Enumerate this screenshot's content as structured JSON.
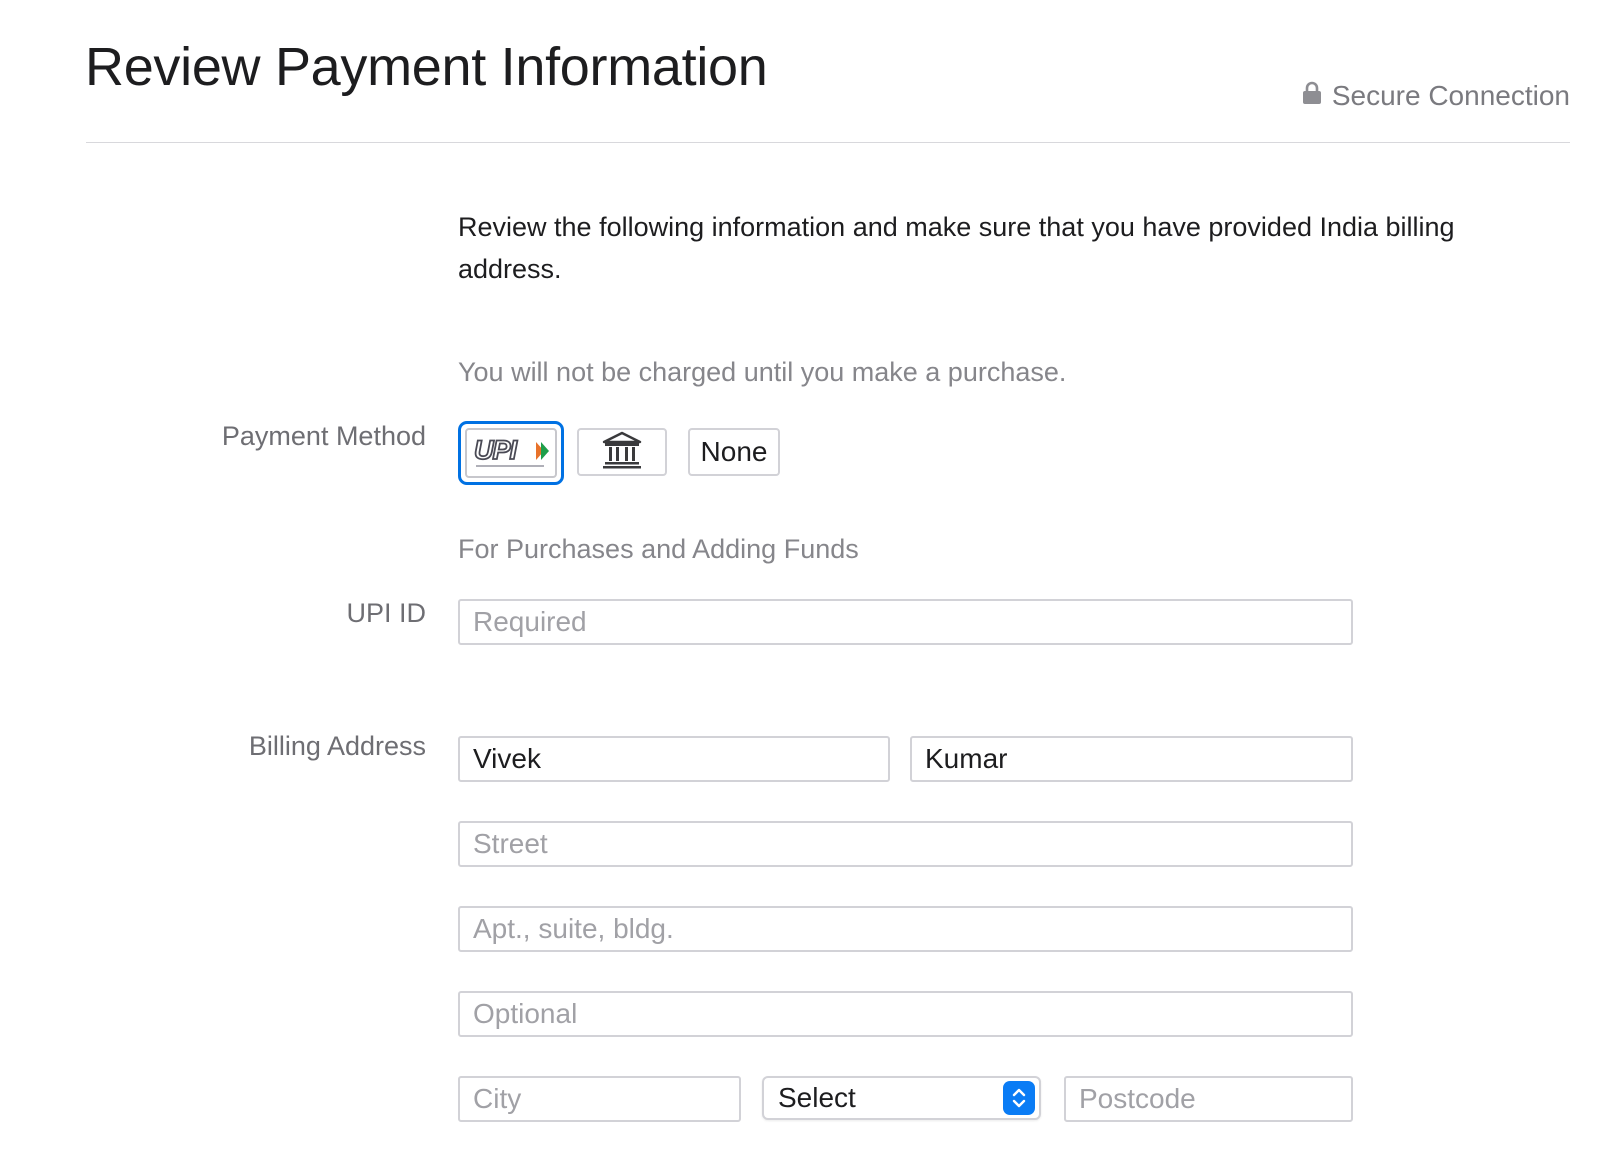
{
  "header": {
    "title": "Review Payment Information",
    "secure_label": "Secure Connection"
  },
  "intro_text": "Review the following information and make sure that you have provided India billing address.",
  "charge_note": "You will not be charged until you make a purchase.",
  "payment_method": {
    "label": "Payment Method",
    "options": [
      {
        "id": "upi",
        "logo_text": "UPI",
        "icon": "upi-logo",
        "selected": true
      },
      {
        "id": "netbanking",
        "icon": "bank-icon",
        "selected": false
      },
      {
        "id": "none",
        "label": "None",
        "selected": false
      }
    ],
    "accent_color": "#0071e3"
  },
  "purchases_label": "For Purchases and Adding Funds",
  "upi_id": {
    "label": "UPI ID",
    "placeholder": "Required",
    "value": ""
  },
  "billing": {
    "label": "Billing Address",
    "first_name": "Vivek",
    "last_name": "Kumar",
    "street_placeholder": "Street",
    "apt_placeholder": "Apt., suite, bldg.",
    "optional_placeholder": "Optional",
    "city_placeholder": "City",
    "state_select": "Select",
    "postcode_placeholder": "Postcode"
  }
}
